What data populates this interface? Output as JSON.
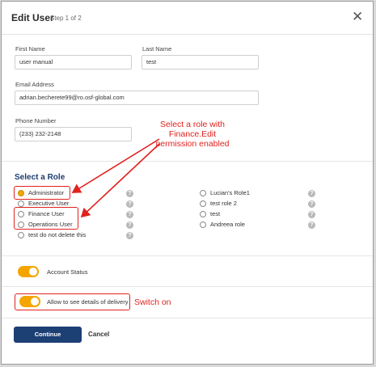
{
  "dialog": {
    "title": "Edit User",
    "step": "Step 1 of 2",
    "close_glyph": "✕"
  },
  "form": {
    "first_name_label": "First Name",
    "first_name_value": "user manual",
    "last_name_label": "Last Name",
    "last_name_value": "test",
    "email_label": "Email Address",
    "email_value": "adrian.becherete99@ro.osf-global.com",
    "phone_label": "Phone Number",
    "phone_value": "(233) 232-2148"
  },
  "roles": {
    "section_title": "Select a Role",
    "left": [
      {
        "label": "Administrator",
        "checked": true
      },
      {
        "label": "Executive User",
        "checked": false
      },
      {
        "label": "Finance User",
        "checked": false
      },
      {
        "label": "Operations User",
        "checked": false
      },
      {
        "label": "test do not delete this",
        "checked": false
      }
    ],
    "right": [
      {
        "label": "Lucian's Role1",
        "checked": false
      },
      {
        "label": "test role 2",
        "checked": false
      },
      {
        "label": "test",
        "checked": false
      },
      {
        "label": "Andreea role",
        "checked": false
      }
    ],
    "help_glyph": "?"
  },
  "toggles": {
    "account_status_label": "Account Status",
    "account_status_on": true,
    "delivery_label": "Allow to see details of delivery",
    "delivery_on": true
  },
  "buttons": {
    "continue": "Continue",
    "cancel": "Cancel"
  },
  "annotations": {
    "role_note_line1": "Select a role with",
    "role_note_line2": "Finance.Edit",
    "role_note_line3": "permission enabled",
    "switch_note": "Switch on",
    "color": "#e0221e"
  },
  "colors": {
    "accent": "#f5a500",
    "primary": "#1c3f74"
  }
}
